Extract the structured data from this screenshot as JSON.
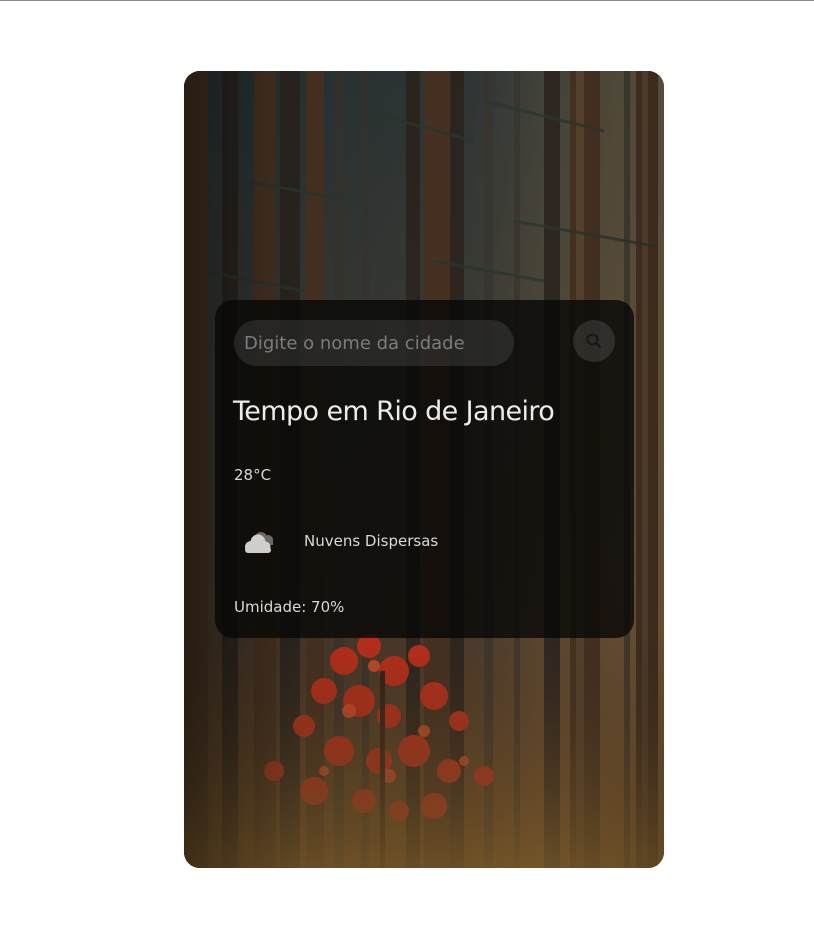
{
  "search": {
    "placeholder": "Digite o nome da cidade",
    "value": ""
  },
  "weather": {
    "title": "Tempo em Rio de Janeiro",
    "temperature": "28°C",
    "condition": "Nuvens Dispersas",
    "condition_icon": "cloud-icon",
    "humidity": "Umidade: 70%"
  },
  "icons": {
    "search_button": "search-icon"
  },
  "colors": {
    "card_background": "#080706",
    "text": "#e6e6e6",
    "placeholder": "#7c7c7c",
    "accent_leaves": "#d9391f"
  }
}
